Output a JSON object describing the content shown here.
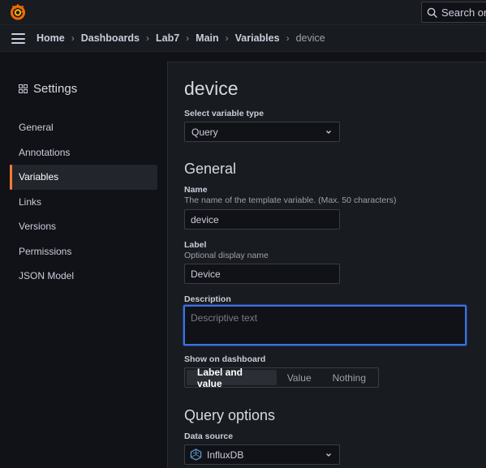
{
  "search": {
    "placeholder": "Search or jump to..."
  },
  "breadcrumbs": [
    "Home",
    "Dashboards",
    "Lab7",
    "Main",
    "Variables",
    "device"
  ],
  "sidebar": {
    "title": "Settings",
    "items": [
      {
        "label": "General"
      },
      {
        "label": "Annotations"
      },
      {
        "label": "Variables"
      },
      {
        "label": "Links"
      },
      {
        "label": "Versions"
      },
      {
        "label": "Permissions"
      },
      {
        "label": "JSON Model"
      }
    ],
    "active_item": "Variables"
  },
  "form": {
    "title": "device",
    "variable_type": {
      "label": "Select variable type",
      "value": "Query"
    },
    "general_heading": "General",
    "name": {
      "label": "Name",
      "description": "The name of the template variable. (Max. 50 characters)",
      "value": "device"
    },
    "label_field": {
      "label": "Label",
      "description": "Optional display name",
      "value": "Device"
    },
    "description": {
      "label": "Description",
      "placeholder": "Descriptive text"
    },
    "show_on_dashboard": {
      "label": "Show on dashboard",
      "options": [
        "Label and value",
        "Value",
        "Nothing"
      ],
      "selected": "Label and value"
    },
    "query_options_heading": "Query options",
    "data_source": {
      "label": "Data source",
      "value": "InfluxDB"
    }
  },
  "colors": {
    "accent": "#ff7a33",
    "focus": "#3d71d9",
    "background": "#111217",
    "panel": "#181b1f"
  }
}
